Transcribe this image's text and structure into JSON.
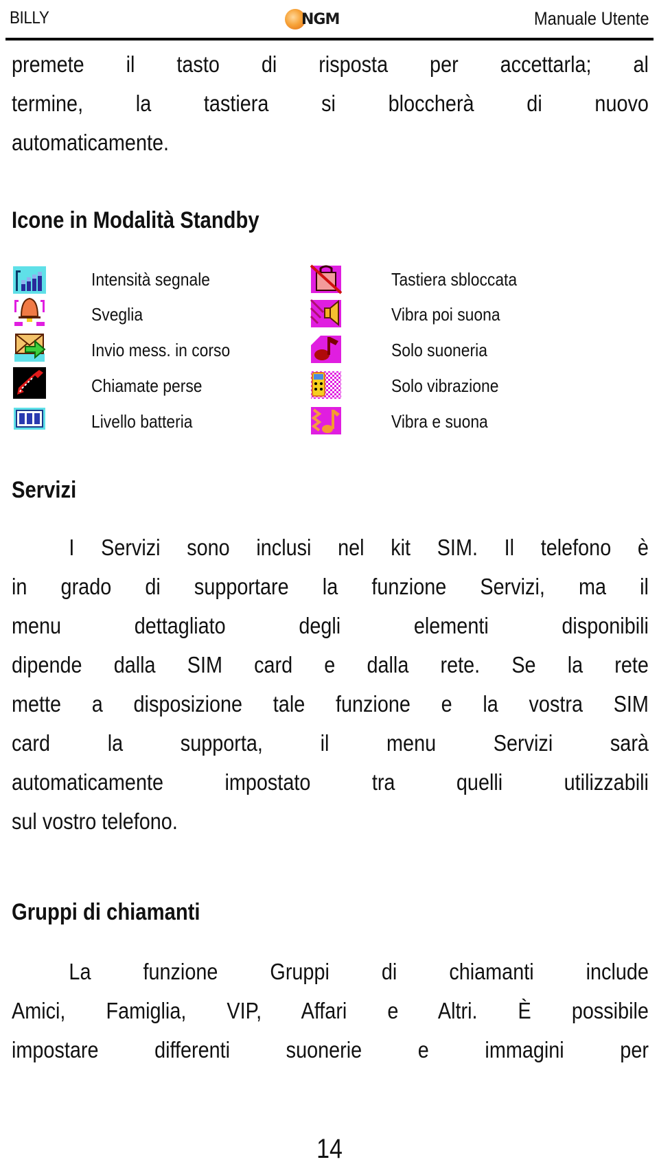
{
  "header": {
    "left": "BILLY",
    "logo_text": "NGM",
    "right": "Manuale Utente"
  },
  "intro_paragraph": {
    "lines": [
      "premete il tasto di risposta per accettarla; al",
      "termine, la tastiera si bloccherà di nuovo",
      "automaticamente."
    ]
  },
  "icons_section": {
    "title": "Icone in Modalità Standby",
    "left_column": [
      {
        "icon": "signal-strength-icon",
        "label": "Intensità segnale"
      },
      {
        "icon": "alarm-bell-icon",
        "label": "Sveglia"
      },
      {
        "icon": "sending-message-icon",
        "label": "Invio mess. in corso"
      },
      {
        "icon": "missed-calls-icon",
        "label": "Chiamate perse"
      },
      {
        "icon": "battery-level-icon",
        "label": "Livello batteria"
      }
    ],
    "right_column": [
      {
        "icon": "keypad-unlocked-icon",
        "label": "Tastiera sbloccata"
      },
      {
        "icon": "vibrate-then-ring-icon",
        "label": "Vibra poi suona"
      },
      {
        "icon": "ring-only-icon",
        "label": "Solo suoneria"
      },
      {
        "icon": "vibrate-only-icon",
        "label": "Solo vibrazione"
      },
      {
        "icon": "vibrate-and-ring-icon",
        "label": "Vibra e suona"
      }
    ]
  },
  "services_section": {
    "title": "Servizi",
    "lines": [
      "I Servizi sono inclusi nel kit SIM. Il telefono è",
      "in grado di supportare la funzione Servizi, ma il",
      "menu dettagliato degli elementi disponibili",
      "dipende dalla SIM card e dalla rete. Se la rete",
      "mette a disposizione tale funzione e la vostra SIM",
      "card la supporta, il menu Servizi sarà",
      "automaticamente impostato tra quelli utilizzabili",
      "sul vostro telefono."
    ]
  },
  "caller_groups_section": {
    "title": "Gruppi di chiamanti",
    "lines": [
      "La funzione Gruppi di chiamanti include",
      "Amici, Famiglia, VIP, Affari e Altri. È possibile",
      "impostare differenti suonerie e immagini per"
    ]
  },
  "page_number": "14"
}
